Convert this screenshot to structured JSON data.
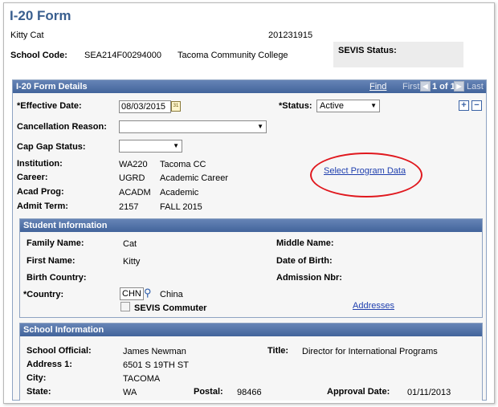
{
  "page": {
    "title": "I-20 Form",
    "student_name": "Kitty Cat",
    "student_id": "201231915",
    "school_code_label": "School Code:",
    "school_code": "SEA214F00294000",
    "school_name": "Tacoma Community College",
    "sevis_status_label": "SEVIS Status:"
  },
  "details": {
    "header": "I-20 Form Details",
    "find": "Find",
    "first": "First",
    "counter": "1 of 1",
    "last": "Last",
    "effective_date_label": "*Effective Date:",
    "effective_date": "08/03/2015",
    "status_label": "*Status:",
    "status_value": "Active",
    "cancellation_label": "Cancellation Reason:",
    "cancellation_value": "",
    "cap_gap_label": "Cap Gap Status:",
    "cap_gap_value": "",
    "institution_label": "Institution:",
    "institution_code": "WA220",
    "institution_name": "Tacoma CC",
    "career_label": "Career:",
    "career_code": "UGRD",
    "career_name": "Academic Career",
    "acad_prog_label": "Acad Prog:",
    "acad_prog_code": "ACADM",
    "acad_prog_name": "Academic",
    "admit_term_label": "Admit Term:",
    "admit_term_code": "2157",
    "admit_term_name": "FALL 2015",
    "select_program_link": "Select Program Data",
    "plus": "+",
    "minus": "−"
  },
  "student_info": {
    "header": "Student Information",
    "family_name_label": "Family Name:",
    "family_name": "Cat",
    "first_name_label": "First Name:",
    "first_name": "Kitty",
    "birth_country_label": "Birth Country:",
    "middle_name_label": "Middle Name:",
    "dob_label": "Date of Birth:",
    "admission_nbr_label": "Admission Nbr:",
    "country_label": "*Country:",
    "country_code": "CHN",
    "country_name": "China",
    "sevis_commuter_label": "SEVIS Commuter",
    "addresses_link": "Addresses"
  },
  "school_info": {
    "header": "School Information",
    "official_label": "School Official:",
    "official": "James Newman",
    "title_label": "Title:",
    "title": "Director for International Programs",
    "address_label": "Address 1:",
    "address": "6501 S 19TH ST",
    "city_label": "City:",
    "city": "TACOMA",
    "state_label": "State:",
    "state": "WA",
    "postal_label": "Postal:",
    "postal": "98466",
    "approval_label": "Approval Date:",
    "approval_date": "01/11/2013"
  },
  "colors": {
    "accent": "#42649b",
    "title": "#3a5f8f",
    "link": "#1f3fae",
    "annotation": "#e0181e"
  }
}
